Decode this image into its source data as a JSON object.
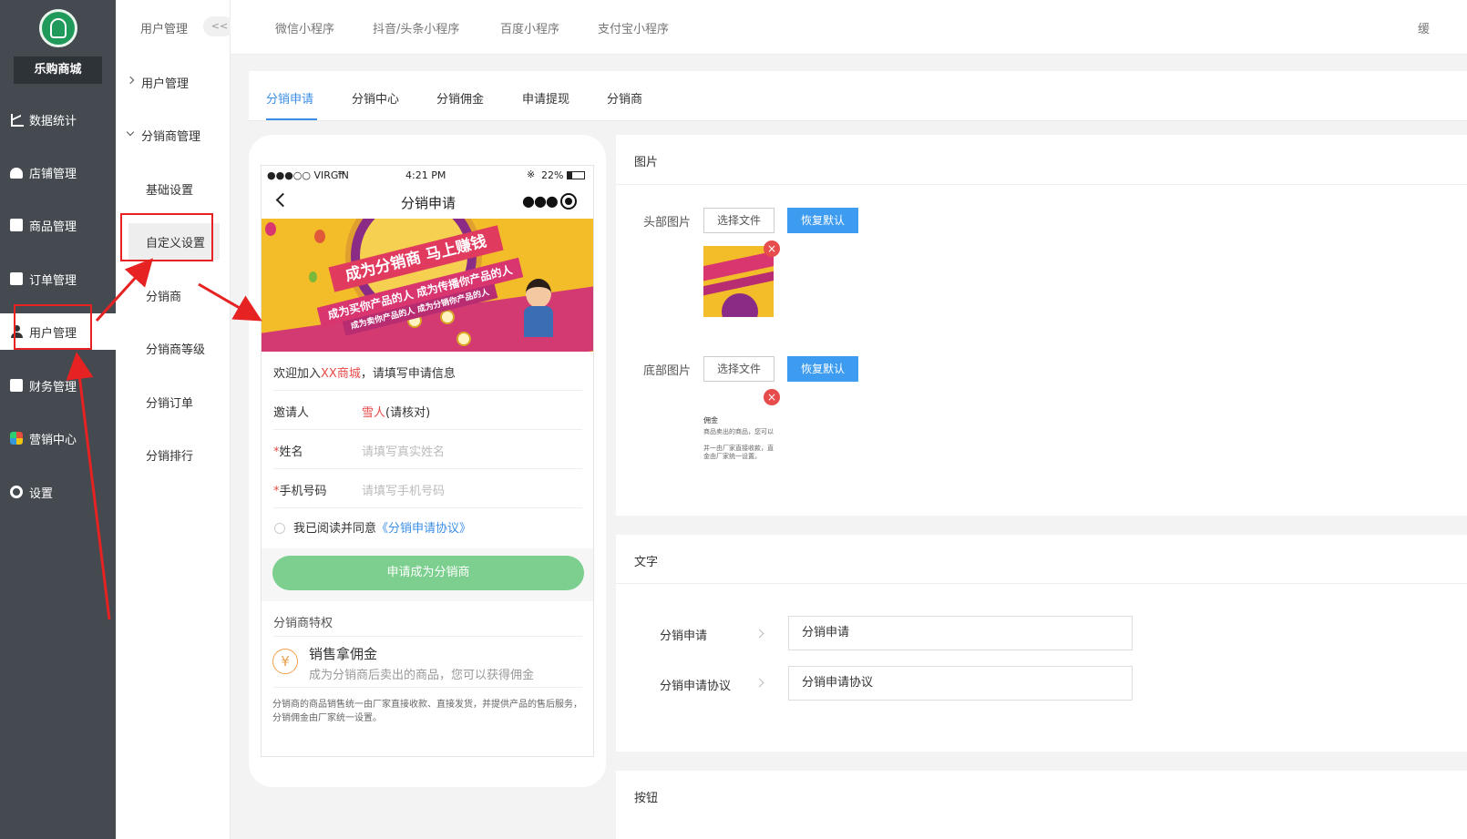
{
  "brand": {
    "name": "乐购商城"
  },
  "sidebar": {
    "items": [
      {
        "label": "数据统计",
        "icon": "chart-icon"
      },
      {
        "label": "店铺管理",
        "icon": "shop-icon"
      },
      {
        "label": "商品管理",
        "icon": "goods-icon"
      },
      {
        "label": "订单管理",
        "icon": "order-icon"
      },
      {
        "label": "用户管理",
        "icon": "user-icon"
      },
      {
        "label": "财务管理",
        "icon": "finance-icon"
      },
      {
        "label": "营销中心",
        "icon": "marketing-icon"
      },
      {
        "label": "设置",
        "icon": "gear-icon"
      }
    ],
    "active": "用户管理"
  },
  "subnav": {
    "header": "用户管理",
    "collapse": "<<",
    "group1": "用户管理",
    "group2": "分销商管理",
    "items": [
      "基础设置",
      "自定义设置",
      "分销商",
      "分销商等级",
      "分销订单",
      "分销排行"
    ],
    "active": "自定义设置"
  },
  "topbar": {
    "tabs": [
      "微信小程序",
      "抖音/头条小程序",
      "百度小程序",
      "支付宝小程序"
    ],
    "right": "缓"
  },
  "tabs": {
    "items": [
      "分销申请",
      "分销中心",
      "分销佣金",
      "申请提现",
      "分销商"
    ],
    "active": "分销申请"
  },
  "phone": {
    "status": {
      "carrier": "●●●○○ VIRGIN",
      "time": "4:21 PM",
      "battery": "22%"
    },
    "title": "分销申请",
    "banner": {
      "headline": "成为分销商 马上赚钱",
      "line1": "成为买你产品的人 成为传播你产品的人",
      "line2": "成为卖你产品的人 成为分销你产品的人"
    },
    "welcome_pre": "欢迎加入",
    "welcome_mall": "XX商城",
    "welcome_post": "，请填写申请信息",
    "inviter_label": "邀请人",
    "inviter_name": "雪人",
    "inviter_note": "(请核对)",
    "required_mark": "*",
    "name_label": "姓名",
    "name_placeholder": "请填写真实姓名",
    "phone_label": "手机号码",
    "phone_placeholder": "请填写手机号码",
    "agree_text": "我已阅读并同意",
    "agree_link": "《分销申请协议》",
    "apply_button": "申请成为分销商",
    "privilege_title": "分销商特权",
    "privilege_icon": "¥",
    "privilege_heading": "销售拿佣金",
    "privilege_desc": "成为分销商后卖出的商品，您可以获得佣金",
    "privilege_note": "分销商的商品销售统一由厂家直接收款、直接发货，并提供产品的售后服务，分销佣金由厂家统一设置。"
  },
  "images_panel": {
    "title": "图片",
    "header_label": "头部图片",
    "footer_label": "底部图片",
    "choose_file": "选择文件",
    "restore_default": "恢复默认",
    "delete_glyph": "×",
    "footer_preview": {
      "title": "佣金",
      "line1": "商品卖出的商品，您可以",
      "line2": "并一由厂家直接收款，直接发",
      "line3": "金由厂家统一设置。"
    }
  },
  "text_panel": {
    "title": "文字",
    "rows": [
      {
        "label": "分销申请",
        "value": "分销申请"
      },
      {
        "label": "分销申请协议",
        "value": "分销申请协议"
      }
    ]
  },
  "button_panel": {
    "title": "按钮"
  },
  "colors": {
    "sidebar_bg": "#444a4f",
    "accent": "#3a8ee6",
    "apply_button": "#7ccf8e",
    "annotation_red": "#e62222"
  }
}
